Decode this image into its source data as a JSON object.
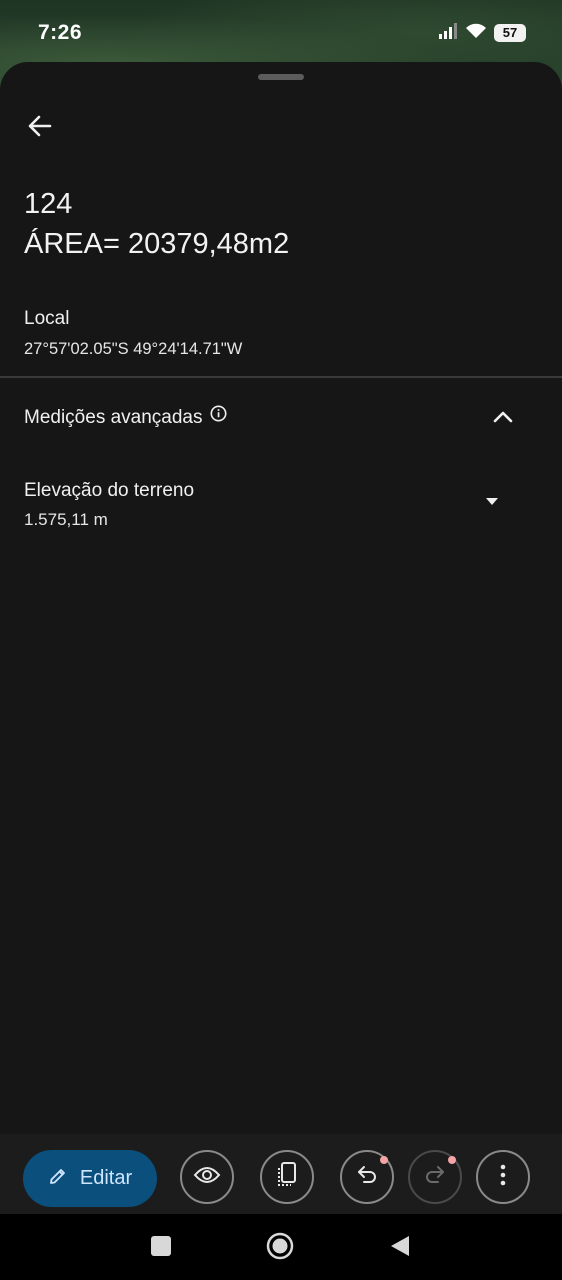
{
  "status_bar": {
    "time": "7:26",
    "battery": "57",
    "icons": [
      "signal-icon",
      "wifi-icon",
      "battery-icon"
    ]
  },
  "header": {
    "back_icon": "arrow-left-icon",
    "title_line1": "124",
    "title_line2": "ÁREA= 20379,48m2"
  },
  "local": {
    "label": "Local",
    "coordinates": "27°57'02.05\"S 49°24'14.71\"W"
  },
  "advanced": {
    "label": "Medições avançadas",
    "info_icon": "info-icon",
    "expanded": true,
    "elevation_label": "Elevação do terreno",
    "elevation_value": "1.575,11 m"
  },
  "toolbar": {
    "edit_label": "Editar",
    "buttons": [
      "view-icon",
      "layers-icon",
      "undo-icon",
      "redo-icon",
      "more-icon"
    ]
  },
  "colors": {
    "background": "#161616",
    "edit_button": "#0b4f7c",
    "edit_text": "#cfe6ff",
    "badge_dot": "#f4a4a4"
  }
}
